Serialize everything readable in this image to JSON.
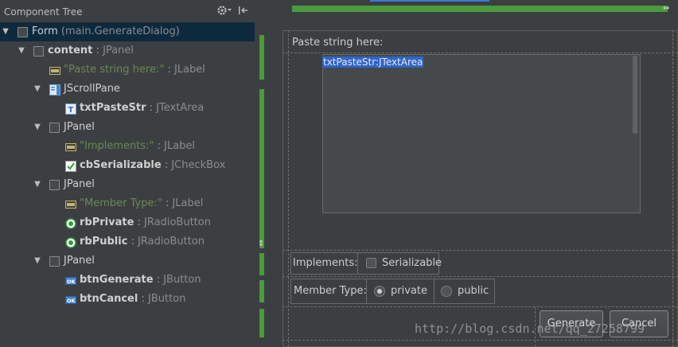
{
  "tree": {
    "title": "Component Tree",
    "items": [
      {
        "name": "Form",
        "cls": "(main.GenerateDialog)"
      },
      {
        "name": "content",
        "sep": " : ",
        "cls": "JPanel"
      },
      {
        "name": "\"Paste string here:\"",
        "sep": " : ",
        "cls": "JLabel"
      },
      {
        "name": "JScrollPane"
      },
      {
        "name": "txtPasteStr",
        "sep": " : ",
        "cls": "JTextArea"
      },
      {
        "name": "JPanel"
      },
      {
        "name": "\"Implements:\"",
        "sep": " : ",
        "cls": "JLabel"
      },
      {
        "name": "cbSerializable",
        "sep": " : ",
        "cls": "JCheckBox"
      },
      {
        "name": "JPanel"
      },
      {
        "name": "\"Member Type:\"",
        "sep": " : ",
        "cls": "JLabel"
      },
      {
        "name": "rbPrivate",
        "sep": " : ",
        "cls": "JRadioButton"
      },
      {
        "name": "rbPublic",
        "sep": " : ",
        "cls": "JRadioButton"
      },
      {
        "name": "JPanel"
      },
      {
        "name": "btnGenerate",
        "sep": " : ",
        "cls": "JButton"
      },
      {
        "name": "btnCancel",
        "sep": " : ",
        "cls": "JButton"
      }
    ],
    "icons": {
      "label": "abc-label-icon",
      "textarea": "text-area-icon",
      "button": "ok-button-icon"
    }
  },
  "design": {
    "paste_label": "Paste string here:",
    "textarea_text": "txtPasteStr:JTextArea",
    "implements_label": "Implements:",
    "serializable_label": "Serializable",
    "member_type_label": "Member Type:",
    "private_label": "private",
    "public_label": "public",
    "generate_label": "Generate",
    "cancel_label": "Cancel",
    "watermark": "http://blog.csdn.net/qq_27258799"
  },
  "colors": {
    "background": "#3c3f41",
    "selection": "#0d293e",
    "green_strip": "#4b9b3c",
    "text_selection": "#2f65ca"
  }
}
